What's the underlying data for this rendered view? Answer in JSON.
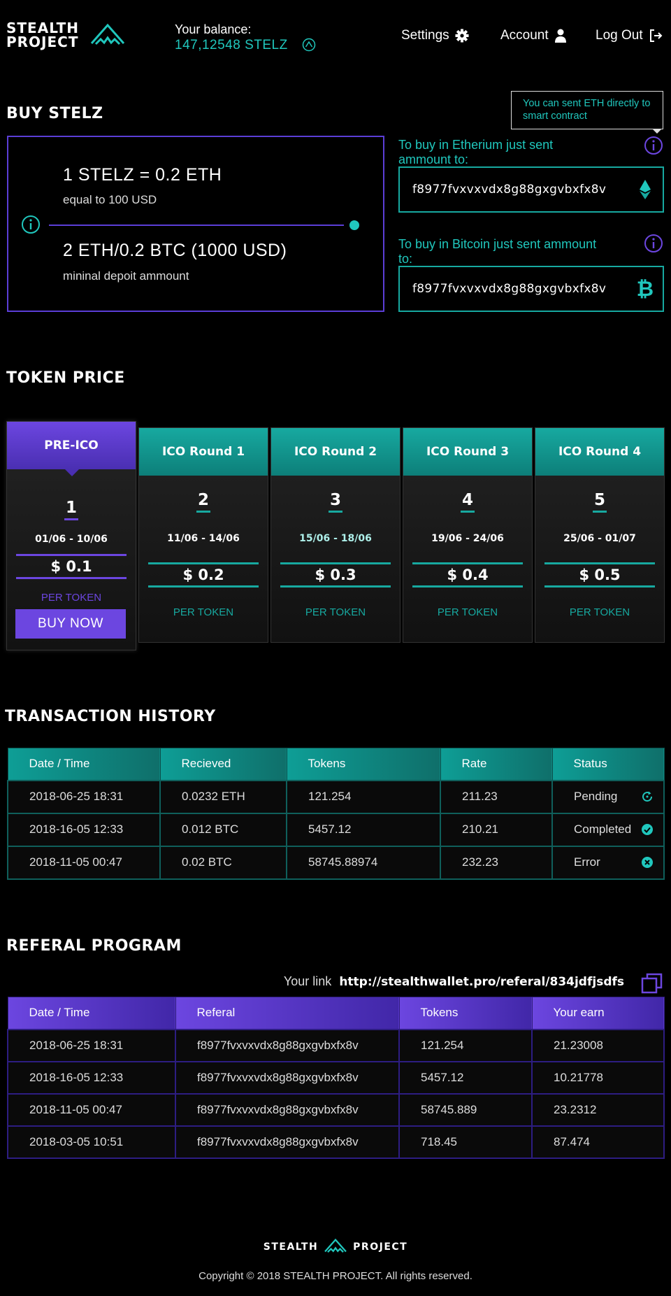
{
  "header": {
    "logo_line1": "STEALTH",
    "logo_line2": "PROJECT",
    "balance_label": "Your balance:",
    "balance_value": "147,12548 STELZ",
    "nav": {
      "settings": "Settings",
      "account": "Account",
      "logout": "Log Out"
    }
  },
  "buy": {
    "title": "BUY STELZ",
    "rate": "1  STELZ = 0.2 ETH",
    "rate_sub": "equal to 100 USD",
    "minimum": "2 ETH/0.2 BTC (1000 USD)",
    "minimum_sub": "mininal depoit ammount",
    "tooltip": "You can sent ETH directly to smart contract",
    "eth_label": "To buy in Etherium just sent ammount to:",
    "eth_address": "f8977fvxvxvdx8g88gxgvbxfx8v",
    "btc_label": "To buy in Bitcoin just sent ammount to:",
    "btc_address": "f8977fvxvxvdx8g88gxgvbxfx8v"
  },
  "token_price": {
    "title": "TOKEN PRICE",
    "per_token": "PER TOKEN",
    "buy_now": "BUY NOW",
    "rounds": [
      {
        "name": "PRE-ICO",
        "num": "1",
        "dates": "01/06 - 10/06",
        "price": "$ 0.1"
      },
      {
        "name": "ICO Round 1",
        "num": "2",
        "dates": "11/06 - 14/06",
        "price": "$ 0.2"
      },
      {
        "name": "ICO Round 2",
        "num": "3",
        "dates": "15/06 - 18/06",
        "price": "$ 0.3"
      },
      {
        "name": "ICO Round 3",
        "num": "4",
        "dates": "19/06 - 24/06",
        "price": "$ 0.4"
      },
      {
        "name": "ICO Round 4",
        "num": "5",
        "dates": "25/06 - 01/07",
        "price": "$ 0.5"
      }
    ]
  },
  "transactions": {
    "title": "TRANSACTION HISTORY",
    "headers": [
      "Date / Time",
      "Recieved",
      "Tokens",
      "Rate",
      "Status"
    ],
    "rows": [
      [
        "2018-06-25 18:31",
        "0.0232 ETH",
        "121.254",
        "211.23",
        "Pending"
      ],
      [
        "2018-16-05 12:33",
        "0.012 BTC",
        "5457.12",
        "210.21",
        "Completed"
      ],
      [
        "2018-11-05 00:47",
        "0.02 BTC",
        "58745.88974",
        "232.23",
        "Error"
      ]
    ],
    "status_icons": [
      "refresh-icon",
      "check-circle-icon",
      "x-circle-icon"
    ]
  },
  "referral": {
    "title": "REFERAL PROGRAM",
    "link_label": "Your link",
    "link": "http://stealthwallet.pro/referal/834jdfjsdfs",
    "headers": [
      "Date / Time",
      "Referal",
      "Tokens",
      "Your earn"
    ],
    "rows": [
      [
        "2018-06-25 18:31",
        "f8977fvxvxvdx8g88gxgvbxfx8v",
        "121.254",
        "21.23008"
      ],
      [
        "2018-16-05 12:33",
        "f8977fvxvxvdx8g88gxgvbxfx8v",
        "5457.12",
        "10.21778"
      ],
      [
        "2018-11-05 00:47",
        "f8977fvxvxvdx8g88gxgvbxfx8v",
        "58745.889",
        "23.2312"
      ],
      [
        "2018-03-05 10:51",
        "f8977fvxvxvdx8g88gxgvbxfx8v",
        "718.45",
        "87.474"
      ]
    ]
  },
  "footer": {
    "logo_left": "STEALTH",
    "logo_right": "PROJECT",
    "copyright": "Copyright © 2018 STEALTH PROJECT. All rights reserved."
  },
  "colors": {
    "teal": "#20c7bd",
    "purple": "#6c46e0",
    "background": "#000000"
  }
}
